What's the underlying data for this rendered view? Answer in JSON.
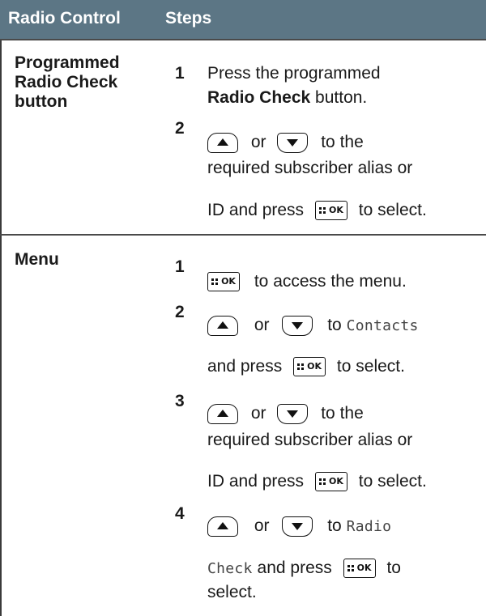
{
  "header": {
    "col_control": "Radio Control",
    "col_steps": "Steps"
  },
  "rows": [
    {
      "control": [
        "Programmed",
        "Radio Check",
        "button"
      ],
      "steps": [
        {
          "num": "1",
          "text": "Press the programmed",
          "bold": "Radio Check",
          "after_bold": "button."
        },
        {
          "num": "2",
          "or": "or",
          "to": "to the",
          "line2": "required subscriber alias or",
          "line3a": "ID and press",
          "line3b": "to select."
        }
      ]
    },
    {
      "control": [
        "Menu"
      ],
      "steps": [
        {
          "num": "1",
          "text": "to access the menu."
        },
        {
          "num": "2",
          "or": "or",
          "to": "to",
          "mono": "Contacts",
          "line2a": "and press",
          "line2b": "to select."
        },
        {
          "num": "3",
          "or": "or",
          "to": "to the",
          "line2": "required subscriber alias or",
          "line3a": "ID and press",
          "line3b": "to select."
        },
        {
          "num": "4",
          "or": "or",
          "to": "to",
          "mono": "Radio",
          "mono2": "Check",
          "line2a": "and press",
          "line2b": "to",
          "line3": "select."
        }
      ]
    }
  ],
  "keys": {
    "up": "up-arrow-key-icon",
    "down": "down-arrow-key-icon",
    "ok": "OK"
  }
}
